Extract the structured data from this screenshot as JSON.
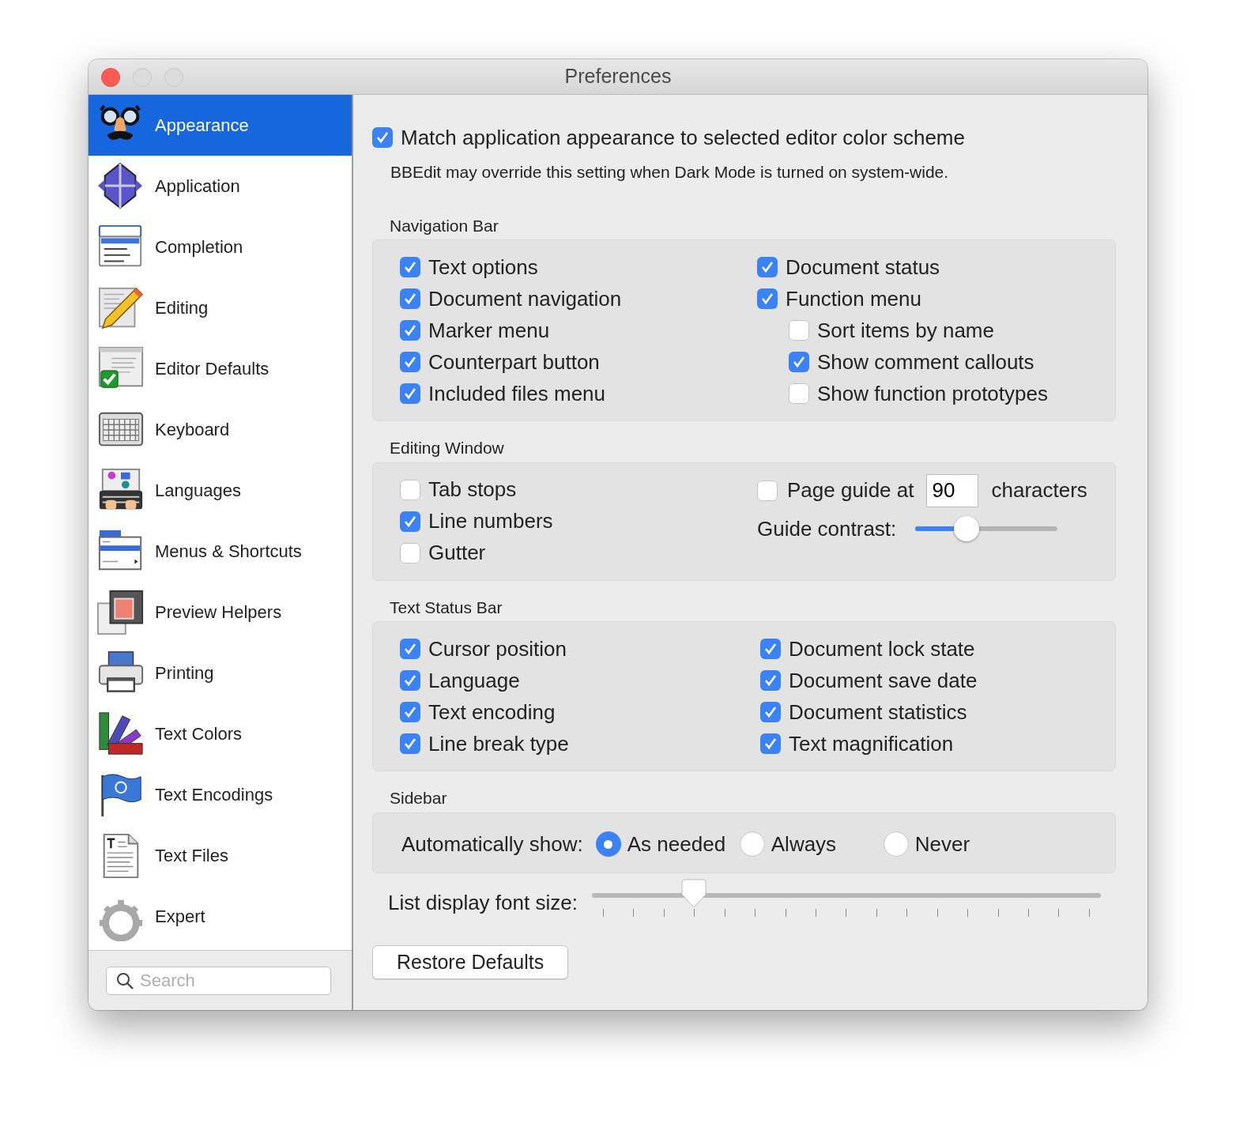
{
  "window": {
    "title": "Preferences"
  },
  "sidebar": {
    "items": [
      {
        "label": "Appearance",
        "selected": true
      },
      {
        "label": "Application",
        "selected": false
      },
      {
        "label": "Completion",
        "selected": false
      },
      {
        "label": "Editing",
        "selected": false
      },
      {
        "label": "Editor Defaults",
        "selected": false
      },
      {
        "label": "Keyboard",
        "selected": false
      },
      {
        "label": "Languages",
        "selected": false
      },
      {
        "label": "Menus & Shortcuts",
        "selected": false
      },
      {
        "label": "Preview Helpers",
        "selected": false
      },
      {
        "label": "Printing",
        "selected": false
      },
      {
        "label": "Text Colors",
        "selected": false
      },
      {
        "label": "Text Encodings",
        "selected": false
      },
      {
        "label": "Text Files",
        "selected": false
      },
      {
        "label": "Expert",
        "selected": false
      }
    ],
    "search": {
      "placeholder": "Search"
    }
  },
  "match_appearance": {
    "label": "Match application appearance to selected editor color scheme",
    "checked": true
  },
  "note": "BBEdit may override this setting when Dark Mode is turned on system-wide.",
  "navigation_bar": {
    "title": "Navigation Bar",
    "columns": [
      [
        {
          "label": "Text options",
          "checked": true
        },
        {
          "label": "Document navigation",
          "checked": true
        },
        {
          "label": "Marker menu",
          "checked": true
        },
        {
          "label": "Counterpart button",
          "checked": true
        },
        {
          "label": "Included files menu",
          "checked": true
        }
      ],
      [
        {
          "label": "Document status",
          "checked": true
        },
        {
          "label": "Function menu",
          "checked": true,
          "children": [
            {
              "label": "Sort items by name",
              "checked": false
            },
            {
              "label": "Show comment callouts",
              "checked": true
            },
            {
              "label": "Show function prototypes",
              "checked": false
            }
          ]
        }
      ]
    ]
  },
  "editing_window": {
    "title": "Editing Window",
    "options": [
      {
        "label": "Tab stops",
        "checked": false
      },
      {
        "label": "Line numbers",
        "checked": true
      },
      {
        "label": "Gutter",
        "checked": false
      }
    ],
    "page_guide": {
      "label": "Page guide at",
      "checked": false,
      "value": "90",
      "unit": "characters"
    },
    "guide_contrast": {
      "label": "Guide contrast:",
      "level": 0.36
    }
  },
  "text_status_bar": {
    "title": "Text Status Bar",
    "columns": [
      [
        {
          "label": "Cursor position",
          "checked": true
        },
        {
          "label": "Language",
          "checked": true
        },
        {
          "label": "Text encoding",
          "checked": true
        },
        {
          "label": "Line break type",
          "checked": true
        }
      ],
      [
        {
          "label": "Document lock state",
          "checked": true
        },
        {
          "label": "Document save date",
          "checked": true
        },
        {
          "label": "Document statistics",
          "checked": true
        },
        {
          "label": "Text magnification",
          "checked": true
        }
      ]
    ]
  },
  "sidebar_section": {
    "title": "Sidebar",
    "label": "Automatically show:",
    "options": [
      {
        "label": "As needed",
        "selected": true
      },
      {
        "label": "Always",
        "selected": false
      },
      {
        "label": "Never",
        "selected": false
      }
    ]
  },
  "list_font_size": {
    "label": "List display font size:",
    "level": 0.1875
  },
  "restore_button": "Restore Defaults"
}
